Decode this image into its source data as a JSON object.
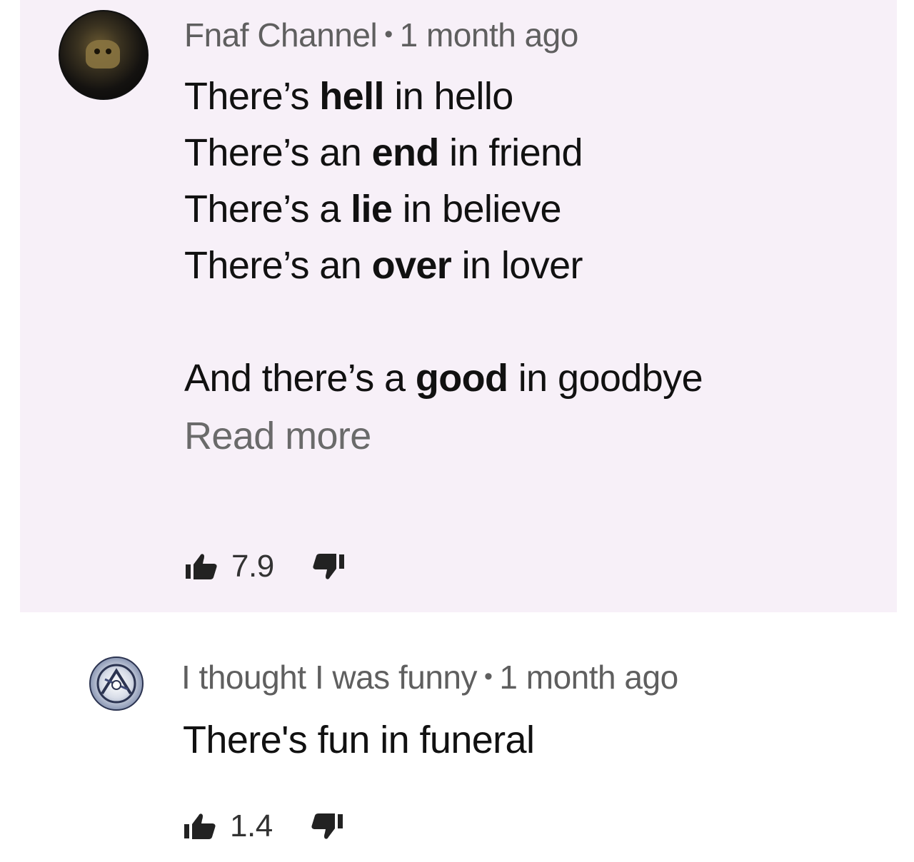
{
  "comments": [
    {
      "author": "Fnaf Channel",
      "separator": "•",
      "time": "1 month ago",
      "lines": [
        {
          "pre": "There’s ",
          "bold": "hell",
          "post": " in hello"
        },
        {
          "pre": "There’s an ",
          "bold": "end",
          "post": " in friend"
        },
        {
          "pre": "There’s a ",
          "bold": "lie",
          "post": " in believe"
        },
        {
          "pre": "There’s an ",
          "bold": "over",
          "post": " in lover"
        },
        {
          "pre": "And there’s a ",
          "bold": "good",
          "post": " in goodbye"
        }
      ],
      "read_more": "Read more",
      "like_count": "7.9",
      "like_icon": "thumbs-up-icon",
      "dislike_icon": "thumbs-down-icon"
    },
    {
      "author": "I thought I was funny",
      "separator": "•",
      "time": "1 month ago",
      "text": "There's fun in funeral",
      "like_count": "1.4",
      "like_icon": "thumbs-up-icon",
      "dislike_icon": "thumbs-down-icon"
    }
  ],
  "colors": {
    "highlight_background": "#f7f0f8",
    "meta_text": "#5f5f5f",
    "body_text": "#111111"
  }
}
